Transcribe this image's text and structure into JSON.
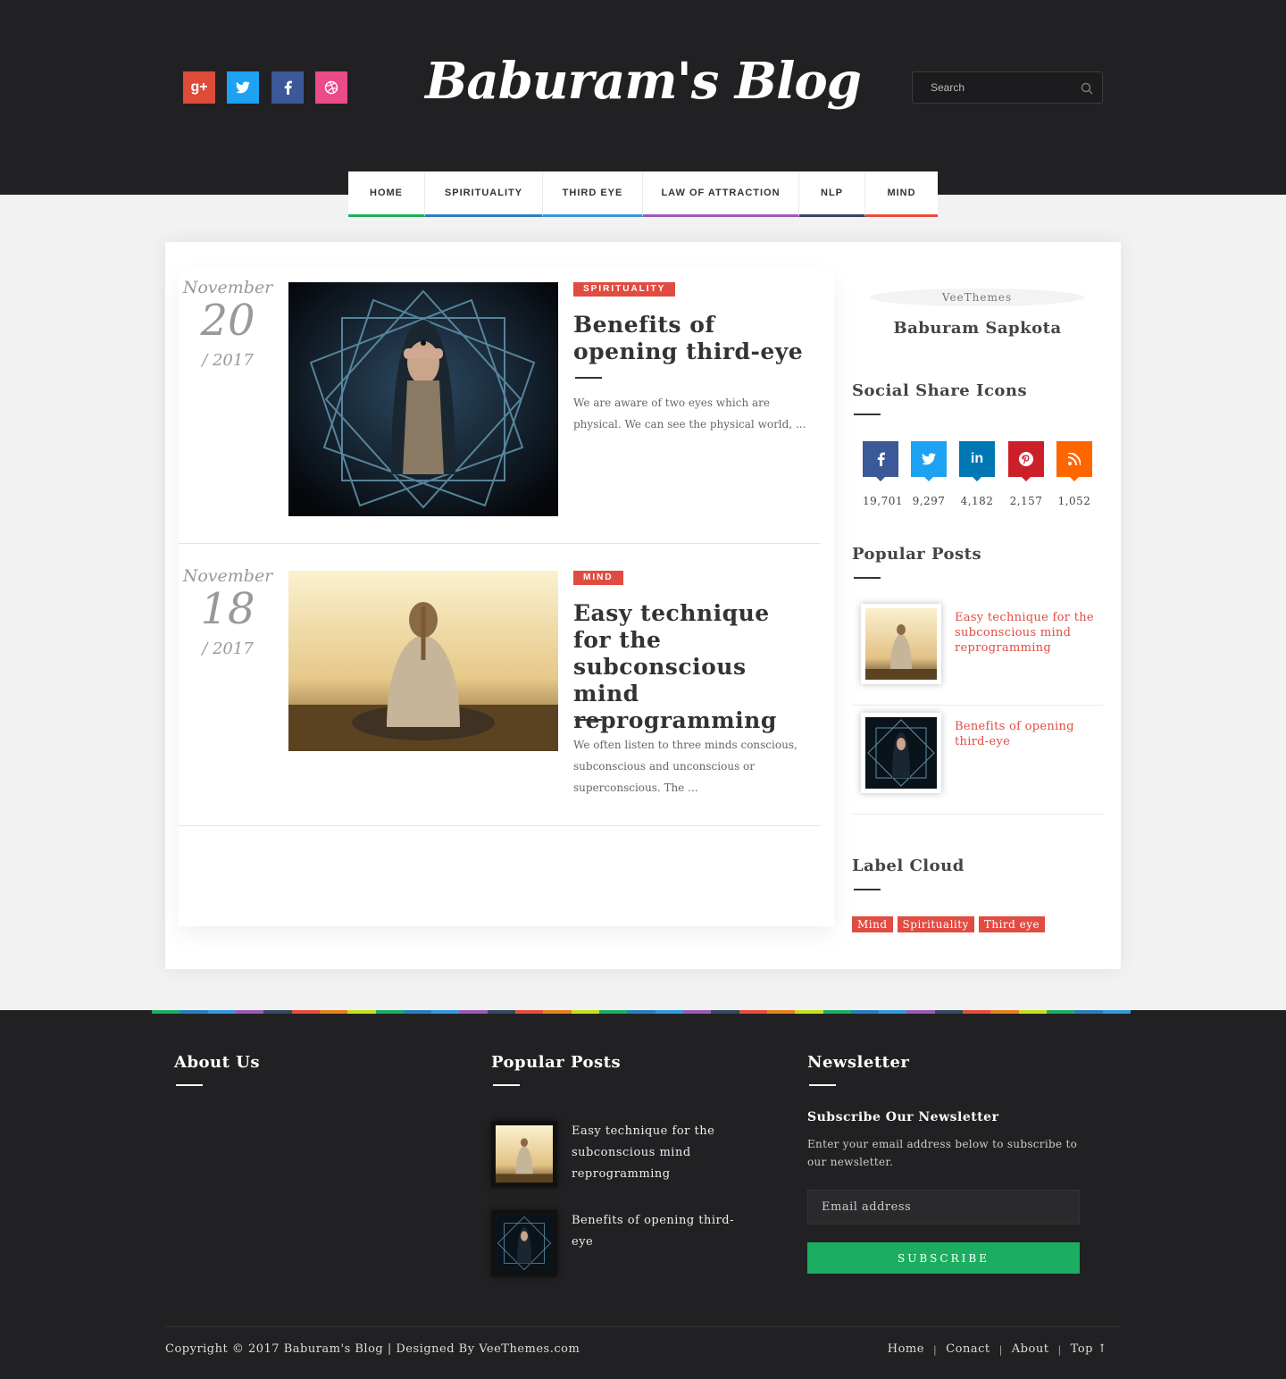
{
  "header": {
    "logo": "Baburam's Blog",
    "search_placeholder": "Search",
    "social": [
      {
        "icon": "google-plus-icon",
        "glyph": "g+",
        "color": "#dd4b39"
      },
      {
        "icon": "twitter-icon",
        "glyph": "t",
        "color": "#1da1f2"
      },
      {
        "icon": "facebook-icon",
        "glyph": "f",
        "color": "#3b5998"
      },
      {
        "icon": "dribbble-icon",
        "glyph": "◎",
        "color": "#ea4c89"
      }
    ]
  },
  "nav": [
    {
      "label": "HOME",
      "color": "#1cae60"
    },
    {
      "label": "SPIRITUALITY",
      "color": "#2a7ec0"
    },
    {
      "label": "THIRD EYE",
      "color": "#3498db"
    },
    {
      "label": "LAW OF ATTRACTION",
      "color": "#9b59b6"
    },
    {
      "label": "NLP",
      "color": "#34495e"
    },
    {
      "label": "MIND",
      "color": "#e74c3c"
    }
  ],
  "posts": [
    {
      "month": "November",
      "day": "20",
      "year": "/ 2017",
      "tag": "SPIRITUALITY",
      "title": "Benefits of opening third-eye",
      "excerpt": "We are aware of two eyes which are physical. We can see the physical world, ..."
    },
    {
      "month": "November",
      "day": "18",
      "year": "/ 2017",
      "tag": "MIND",
      "title": "Easy technique for the subconscious mind reprogramming",
      "excerpt": "We often listen to three minds conscious, subconscious and unconscious or superconscious. The ..."
    }
  ],
  "sidebar": {
    "author_img_alt": "VeeThemes",
    "author_name": "Baburam Sapkota",
    "social_title": "Social Share Icons",
    "counters": [
      {
        "icon": "facebook-icon",
        "glyph": "f",
        "count": "19,701",
        "color": "#3b5998"
      },
      {
        "icon": "twitter-icon",
        "glyph": "t",
        "count": "9,297",
        "color": "#1da1f2"
      },
      {
        "icon": "linkedin-icon",
        "glyph": "in",
        "count": "4,182",
        "color": "#0077b5"
      },
      {
        "icon": "pinterest-icon",
        "glyph": "P",
        "count": "2,157",
        "color": "#cb2027"
      },
      {
        "icon": "rss-icon",
        "glyph": "rss",
        "count": "1,052",
        "color": "#ff6600"
      }
    ],
    "popular_title": "Popular Posts",
    "popular": [
      {
        "title": "Easy technique for the subconscious mind reprogramming"
      },
      {
        "title": "Benefits of opening third-eye"
      }
    ],
    "labels_title": "Label Cloud",
    "labels": [
      "Mind",
      "Spirituality",
      "Third eye"
    ]
  },
  "footer": {
    "about_title": "About Us",
    "popular_title": "Popular Posts",
    "popular": [
      {
        "title": "Easy technique for the subconscious mind reprogramming"
      },
      {
        "title": "Benefits of opening third-eye"
      }
    ],
    "newsletter_title": "Newsletter",
    "newsletter_heading": "Subscribe Our Newsletter",
    "newsletter_desc": "Enter your email address below to subscribe to our newsletter.",
    "email_placeholder": "Email address",
    "subscribe_label": "SUBSCRIBE",
    "copyright": "Copyright © 2017 Baburam's Blog | Designed By VeeThemes.com",
    "links": [
      "Home",
      "Conact",
      "About",
      "Top ↑"
    ],
    "stripe_colors": [
      "#1cae60",
      "#2a7ec0",
      "#3498db",
      "#9b59b6",
      "#34495e",
      "#e74c3c",
      "#e67e22",
      "#c3e01b"
    ]
  }
}
